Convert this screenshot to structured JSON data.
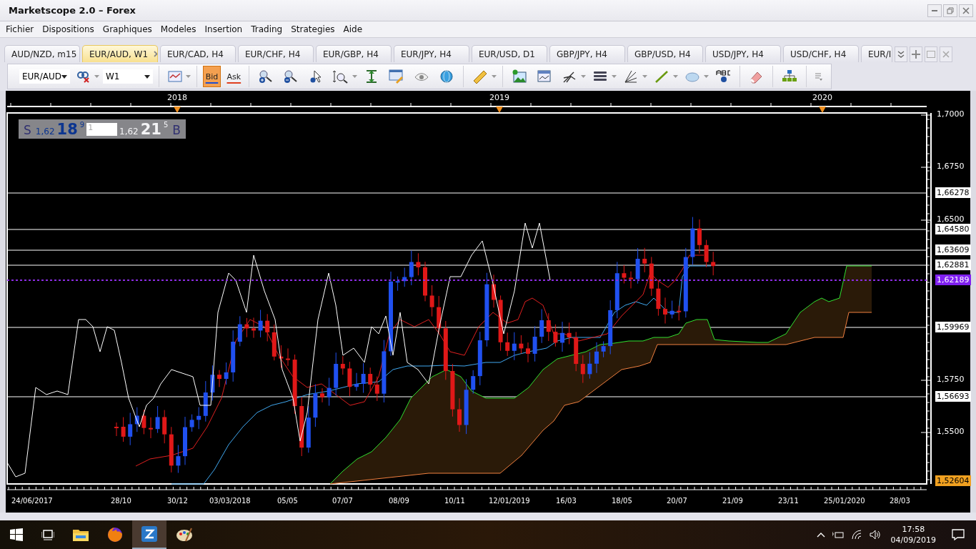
{
  "window": {
    "title": "Marketscope 2.0 – Forex"
  },
  "menu": [
    "Fichier",
    "Dispositions",
    "Graphiques",
    "Modeles",
    "Insertion",
    "Trading",
    "Strategies",
    "Aide"
  ],
  "tabs": [
    {
      "label": "AUD/NZD, m15",
      "selected": false
    },
    {
      "label": "EUR/AUD, W1",
      "selected": true
    },
    {
      "label": "EUR/CAD, H4",
      "selected": false
    },
    {
      "label": "EUR/CHF, H4",
      "selected": false
    },
    {
      "label": "EUR/GBP, H4",
      "selected": false
    },
    {
      "label": "EUR/JPY, H4",
      "selected": false
    },
    {
      "label": "EUR/USD, D1",
      "selected": false
    },
    {
      "label": "GBP/JPY, H4",
      "selected": false
    },
    {
      "label": "GBP/USD, H4",
      "selected": false
    },
    {
      "label": "USD/JPY, H4",
      "selected": false
    },
    {
      "label": "USD/CHF, H4",
      "selected": false
    },
    {
      "label": "EUR/I",
      "selected": false
    }
  ],
  "toolbar": {
    "symbol": "EUR/AUD",
    "timeframe": "W1",
    "price_modes": [
      {
        "label": "Bid",
        "selected": true
      },
      {
        "label": "Ask",
        "selected": false
      }
    ]
  },
  "quote_panel": {
    "sell_label": "S",
    "sell_prefix": "1,62",
    "sell_big": "18",
    "sell_pip": "9",
    "amount": "1",
    "buy_prefix": "1,62",
    "buy_big": "21",
    "buy_pip": "5",
    "buy_label": "B"
  },
  "chart": {
    "years": [
      "2018",
      "2019",
      "2020"
    ],
    "price_ticks": [
      "1,7000",
      "1,6750",
      "1,6500",
      "1,5750",
      "1,5500"
    ],
    "levels": [
      "1,66278",
      "1,64580",
      "1,63609",
      "1,62881",
      "1,59969",
      "1,56693"
    ],
    "current_price": "1,62189",
    "low_price": "1,52604",
    "dates": [
      "24/06/2017",
      "28/10",
      "30/12",
      "03/03/2018",
      "05/05",
      "07/07",
      "08/09",
      "10/11",
      "12/01/2019",
      "16/03",
      "18/05",
      "20/07",
      "21/09",
      "23/11",
      "25/01/2020",
      "28/03"
    ]
  },
  "taskbar": {
    "time": "17:58",
    "date": "04/09/2019"
  }
}
